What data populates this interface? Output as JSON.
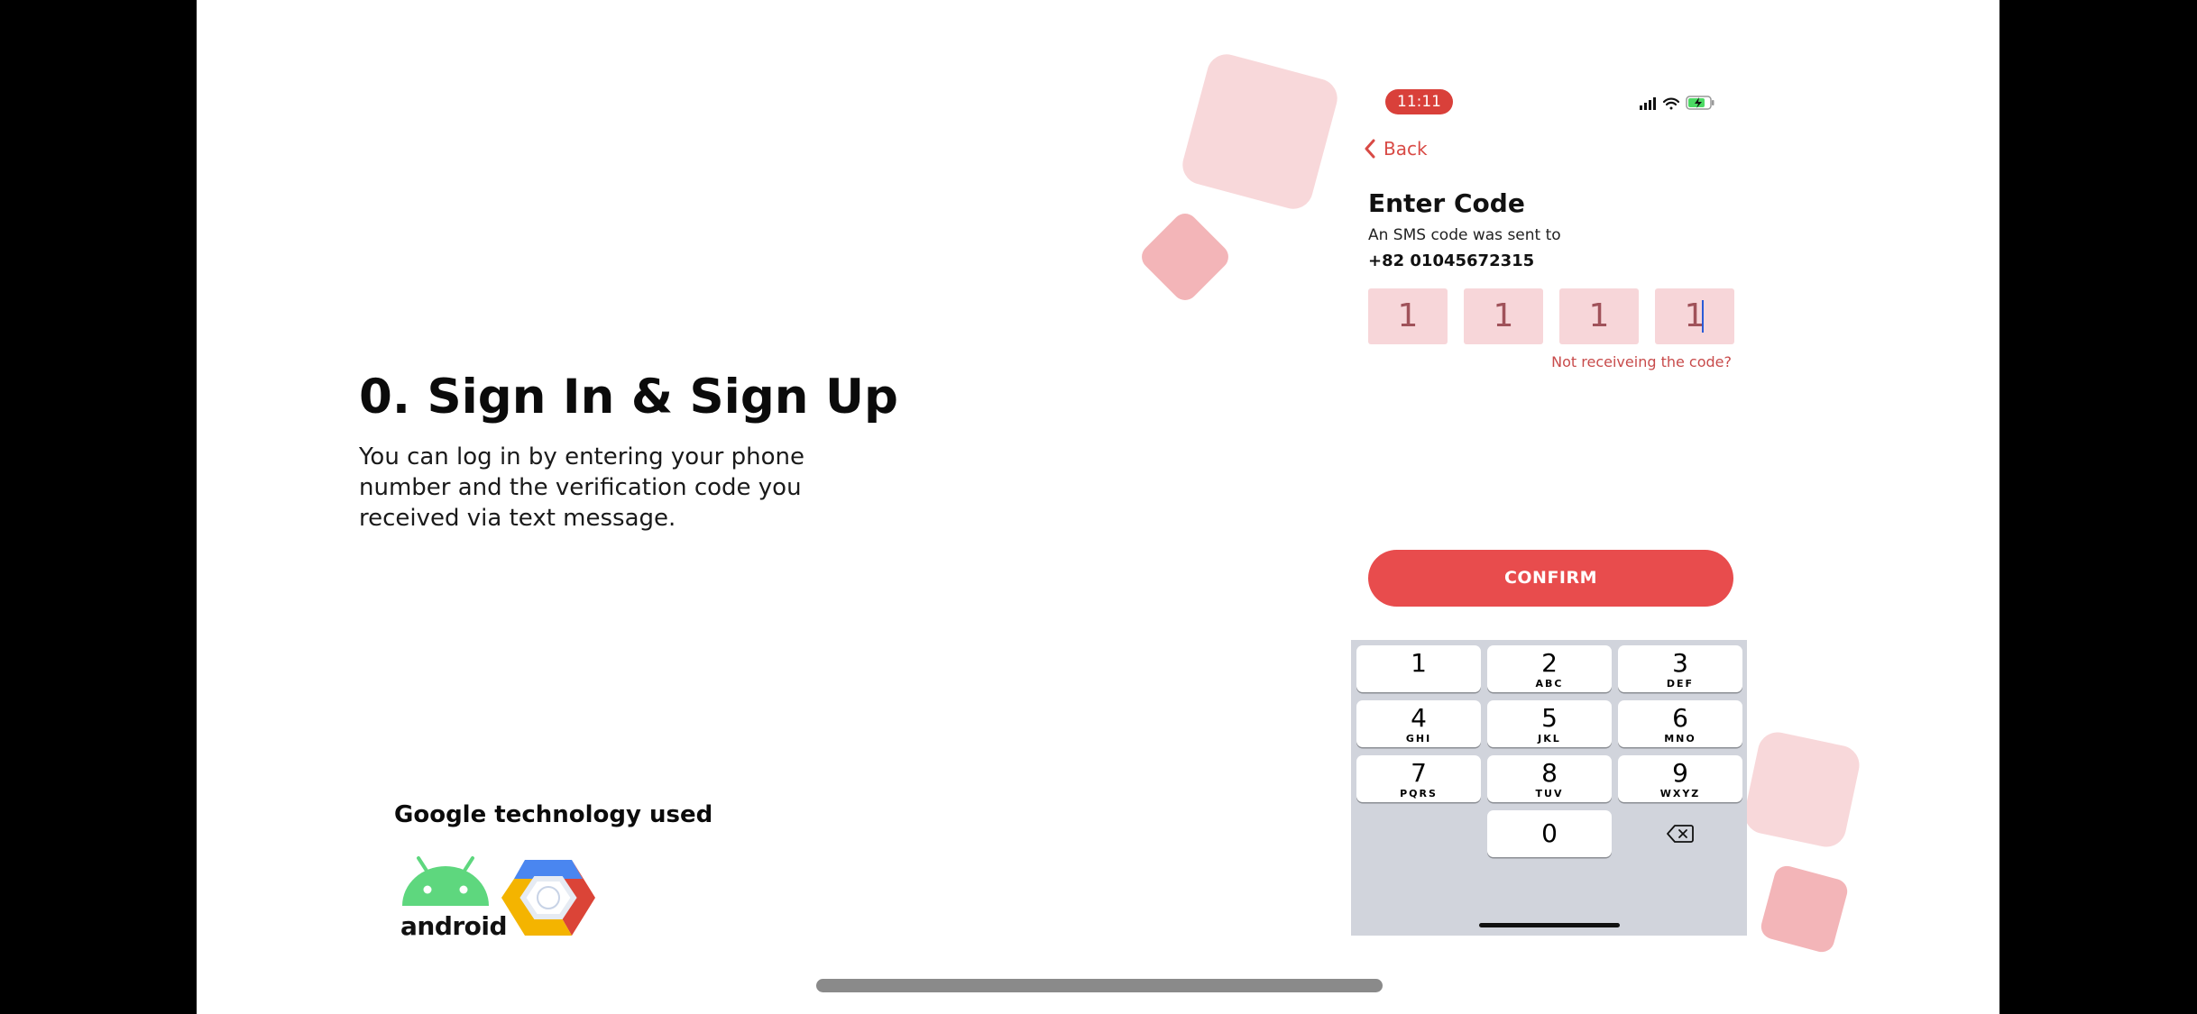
{
  "slide": {
    "title": "0. Sign In & Sign Up",
    "description": "You can log in by entering your phone number and the verification code you received via text message.",
    "tech_heading": "Google technology used",
    "tech_logos": [
      {
        "name": "android",
        "label": "android",
        "color": "#5ed77e"
      },
      {
        "name": "google-cloud",
        "colors": [
          "#4a86f0",
          "#db4437",
          "#f4b400"
        ]
      }
    ]
  },
  "phone": {
    "status_time": "11:11",
    "back_label": "Back",
    "title": "Enter Code",
    "sms_text": "An SMS code was sent to",
    "phone_number": "+82 01045672315",
    "code_digits": [
      "1",
      "1",
      "1",
      "1"
    ],
    "resend_label": "Not receiveing the code?",
    "confirm_label": "CONFIRM",
    "keypad": [
      {
        "num": "1",
        "letters": ""
      },
      {
        "num": "2",
        "letters": "ABC"
      },
      {
        "num": "3",
        "letters": "DEF"
      },
      {
        "num": "4",
        "letters": "GHI"
      },
      {
        "num": "5",
        "letters": "JKL"
      },
      {
        "num": "6",
        "letters": "MNO"
      },
      {
        "num": "7",
        "letters": "PQRS"
      },
      {
        "num": "8",
        "letters": "TUV"
      },
      {
        "num": "9",
        "letters": "WXYZ"
      },
      {
        "num": "0",
        "letters": ""
      }
    ]
  },
  "colors": {
    "accent": "#e84c4d",
    "code_box": "#f7d6d9",
    "status_pill": "#d9403a",
    "keyboard_bg": "#d1d4dc",
    "deco_light": "#f8d8da",
    "deco_mid": "#f3b5b8"
  }
}
